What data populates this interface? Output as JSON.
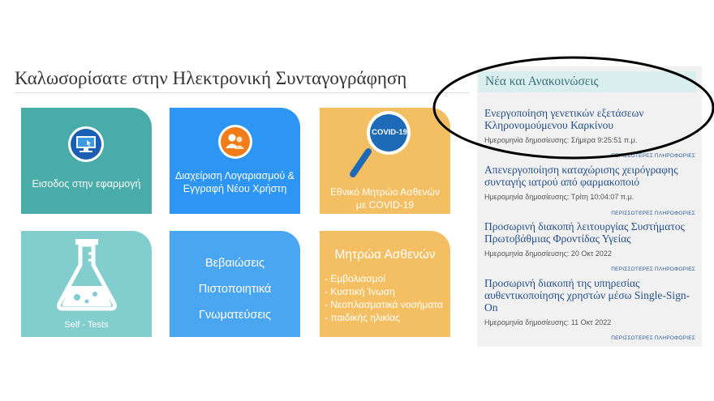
{
  "page": {
    "title": "Καλωσορίσατε στην Ηλεκτρονική Συνταγογράφηση"
  },
  "tiles": {
    "login": "Εισοδος στην εφαρμογή",
    "account": [
      "Διαχείριση Λογαριασμού &",
      "Εγγραφή Νέου Χρήστη"
    ],
    "covid": {
      "badge": "COVID-19",
      "label": [
        "Εθνικό Μητρώο Ασθενών",
        "με COVID-19"
      ]
    },
    "selftests": "Self - Tests",
    "certificates": [
      "Βεβαιώσεις",
      "Πιστοποιητικά",
      "Γνωματεύσεις"
    ],
    "registries": {
      "title": "Μητρώα Ασθενών",
      "items": [
        "Εμβολιασμοί",
        "Κυστική Ίνωση",
        "Νεοπλασματικά νοσήματα",
        "παιδικής ηλικίας"
      ]
    }
  },
  "news": {
    "heading": "Νέα και Ανακοινώσεις",
    "more_label": "ΠΕΡΙΣΣΟΤΕΡΕΣ ΠΛΗΡΟΦΟΡΙΕΣ",
    "items": [
      {
        "title": "Ενεργοποίηση γενετικών εξετάσεων Κληρονομούμενου Καρκίνου",
        "date": "Ημερομηνία δημοσίευσης: Σήμερα 9:25:51 π.μ."
      },
      {
        "title": "Απενεργοποίηση καταχώρισης χειρόγραφης συνταγής ιατρού από φαρμακοποιό",
        "date": "Ημερομηνία δημοσίευσης: Τρίτη 10:04:07 π.μ."
      },
      {
        "title": "Προσωρινή διακοπή λειτουργίας Συστήματος Πρωτοβάθμιας Φροντίδας Υγείας",
        "date": "Ημερομηνία δημοσίευσης: 20 Οκτ 2022"
      },
      {
        "title": "Προσωρινή διακοπή της υπηρεσίας αυθεντικοποίησης χρηστών μέσω Single-Sign-On",
        "date": "Ημερομηνία δημοσίευσης: 11 Οκτ 2022"
      }
    ]
  },
  "colors": {
    "accent_teal": "#4aaca8",
    "accent_blue": "#2d95f3",
    "accent_orange": "#f4bf62",
    "news_link": "#244f8a"
  }
}
